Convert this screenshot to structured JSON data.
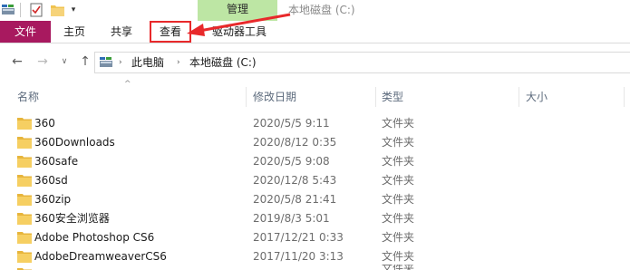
{
  "window": {
    "contextual_tab": "管理",
    "title": "本地磁盘 (C:)"
  },
  "quick_access": {
    "dropdown_glyph": "▾"
  },
  "ribbon": {
    "tabs": [
      {
        "label": "文件"
      },
      {
        "label": "主页"
      },
      {
        "label": "共享"
      },
      {
        "label": "查看"
      },
      {
        "label": "驱动器工具"
      }
    ]
  },
  "colors": {
    "file_tab": "#a8195f",
    "manage_tab": "#bde6a4",
    "highlight": "#e8292b",
    "folder": "#f0c350"
  },
  "nav": {
    "back_glyph": "←",
    "forward_glyph": "→",
    "recent_glyph": "∨",
    "up_glyph": "↑"
  },
  "address": {
    "separator_glyph": "›",
    "crumbs": [
      "此电脑",
      "本地磁盘 (C:)"
    ]
  },
  "columns": {
    "sort_glyph": "^",
    "name": "名称",
    "date": "修改日期",
    "type": "类型",
    "size": "大小"
  },
  "files": [
    {
      "name": "360",
      "date": "2020/5/5 9:11",
      "type": "文件夹"
    },
    {
      "name": "360Downloads",
      "date": "2020/8/12 0:35",
      "type": "文件夹"
    },
    {
      "name": "360safe",
      "date": "2020/5/5 9:08",
      "type": "文件夹"
    },
    {
      "name": "360sd",
      "date": "2020/12/8 5:43",
      "type": "文件夹"
    },
    {
      "name": "360zip",
      "date": "2020/5/8 21:41",
      "type": "文件夹"
    },
    {
      "name": "360安全浏览器",
      "date": "2019/8/3 5:01",
      "type": "文件夹"
    },
    {
      "name": "Adobe Photoshop CS6",
      "date": "2017/12/21 0:33",
      "type": "文件夹"
    },
    {
      "name": "AdobeDreamweaverCS6",
      "date": "2017/11/20 3:13",
      "type": "文件夹"
    },
    {
      "name": "",
      "date": "",
      "type": "文件夹"
    }
  ]
}
